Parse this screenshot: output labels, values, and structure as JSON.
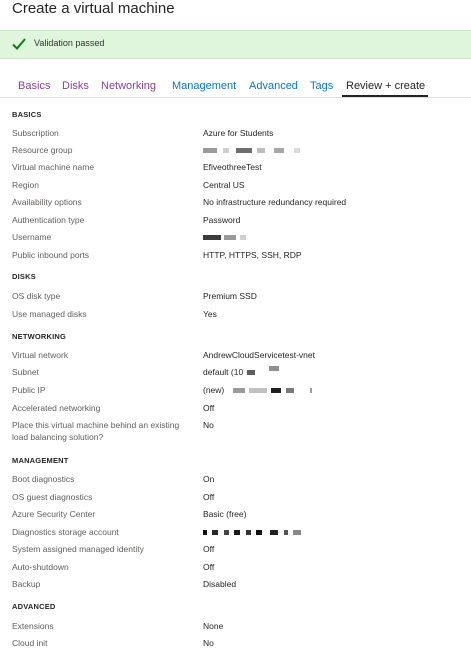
{
  "page": {
    "title": "Create a virtual machine"
  },
  "banner": {
    "text": "Validation passed",
    "icon": "check-icon",
    "color": "#107c10"
  },
  "tabs": [
    {
      "label": "Basics",
      "color": "#8a3f9a"
    },
    {
      "label": "Disks",
      "color": "#8a3f9a"
    },
    {
      "label": "Networking",
      "color": "#8a3f9a"
    },
    {
      "label": "Management",
      "color": "#0078d4"
    },
    {
      "label": "Advanced",
      "color": "#0078d4"
    },
    {
      "label": "Tags",
      "color": "#0078d4"
    },
    {
      "label": "Review + create",
      "active": true
    }
  ],
  "sections": {
    "basics": "BASICS",
    "disks": "DISKS",
    "networking": "NETWORKING",
    "management": "MANAGEMENT",
    "advanced": "ADVANCED"
  },
  "rows": [
    {
      "label": "Subscription",
      "value": "Azure for Students"
    },
    {
      "label": "Resource group",
      "value": ""
    },
    {
      "label": "Virtual machine name",
      "value": "EfiveothreeTest"
    },
    {
      "label": "Region",
      "value": "Central US"
    },
    {
      "label": "Availability options",
      "value": "No infrastructure redundancy required"
    },
    {
      "label": "Authentication type",
      "value": "Password"
    },
    {
      "label": "Username",
      "value": ""
    },
    {
      "label": "Public inbound ports",
      "value": "HTTP, HTTPS, SSH, RDP"
    },
    {
      "label": "OS disk type",
      "value": "Premium SSD"
    },
    {
      "label": "Use managed disks",
      "value": "Yes"
    },
    {
      "label": "Virtual network",
      "value": "AndrewCloudServicetest-vnet"
    },
    {
      "label": "Subnet",
      "value": "default (10"
    },
    {
      "label": "Public IP",
      "value": "(new)"
    },
    {
      "label": "Accelerated networking",
      "value": "Off"
    },
    {
      "label": "Place this virtual machine behind an existing load balancing solution?",
      "value": "No"
    },
    {
      "label": "Boot diagnostics",
      "value": "On"
    },
    {
      "label": "OS guest diagnostics",
      "value": "Off"
    },
    {
      "label": "Azure Security Center",
      "value": "Basic (free)"
    },
    {
      "label": "Diagnostics storage account",
      "value": ""
    },
    {
      "label": "System assigned managed identity",
      "value": "Off"
    },
    {
      "label": "Auto-shutdown",
      "value": "Off"
    },
    {
      "label": "Backup",
      "value": "Disabled"
    },
    {
      "label": "Extensions",
      "value": "None"
    },
    {
      "label": "Cloud init",
      "value": "No"
    }
  ]
}
